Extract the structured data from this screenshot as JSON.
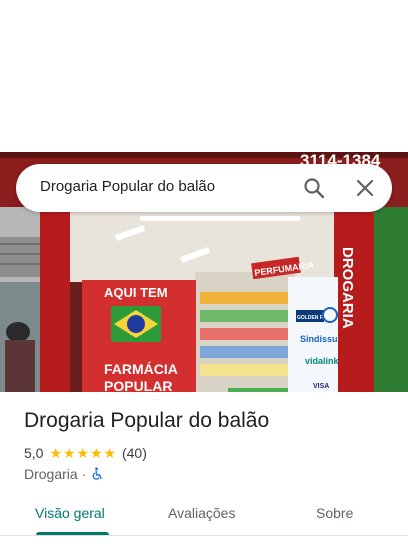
{
  "search": {
    "query": "Drogaria Popular do balão"
  },
  "photo": {
    "sign_phone": "3114-1384",
    "banner_top": "AQUI TEM",
    "banner_bottom_1": "FARMÁCIA",
    "banner_bottom_2": "POPULAR",
    "perfumaria": "PERFUMARIA",
    "drogaria_vertical": "DROGARIA",
    "brand_1": "GOLDEN FARMA",
    "brand_2": "Sindissu",
    "brand_3": "vidalink",
    "brand_4": "VISA"
  },
  "place": {
    "name": "Drogaria Popular do balão",
    "rating": "5,0",
    "stars": 5,
    "review_count": "(40)",
    "category": "Drogaria",
    "separator": "·"
  },
  "tabs": [
    {
      "label": "Visão geral",
      "active": true
    },
    {
      "label": "Avaliações",
      "active": false
    },
    {
      "label": "Sobre",
      "active": false
    }
  ],
  "colors": {
    "accent": "#00796b",
    "star": "#fbbc04",
    "wheelchair": "#1a73e8"
  }
}
